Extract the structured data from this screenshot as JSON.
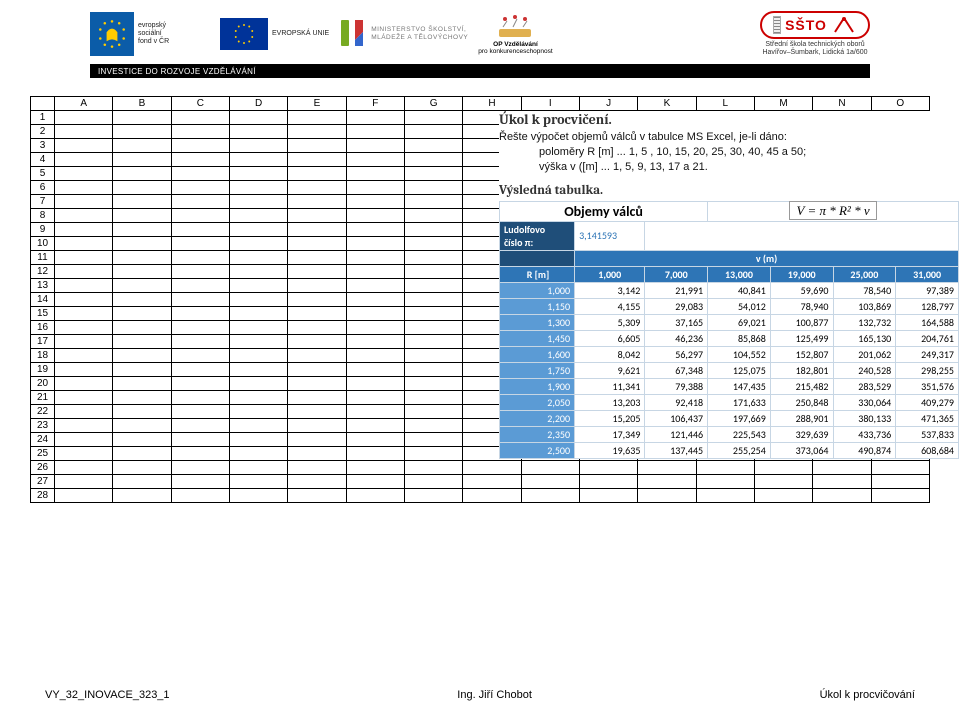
{
  "banner": {
    "esf_lines": [
      "evropský",
      "sociální",
      "fond v ČR"
    ],
    "eu_label": "EVROPSKÁ UNIE",
    "msmt_line1": "MINISTERSTVO ŠKOLSTVÍ,",
    "msmt_line2": "MLÁDEŽE A TĚLOVÝCHOVY",
    "opvk_line1": "OP Vzdělávání",
    "opvk_line2": "pro konkurenceschopnost",
    "ssto_name": "SŠTO",
    "ssto_line1": "Střední škola technických oborů",
    "ssto_line2": "Havířov–Šumbark, Lidická 1a/600",
    "black_bar": "INVESTICE DO ROZVOJE VZDĚLÁVÁNÍ"
  },
  "sheet": {
    "cols": [
      "A",
      "B",
      "C",
      "D",
      "E",
      "F",
      "G",
      "H",
      "I",
      "J",
      "K",
      "L",
      "M",
      "N",
      "O"
    ],
    "rows": 28
  },
  "task": {
    "title": "Úkol k procvičení.",
    "line1": "Řešte výpočet objemů válců v tabulce MS Excel, je-li dáno:",
    "line2": "poloměry R [m] ... 1, 5 , 10, 15, 20, 25, 30, 40, 45 a 50;",
    "line3": "výška v ([m] ... 1, 5, 9, 13, 17 a 21.",
    "subtitle": "Výsledná tabulka."
  },
  "chart_data": {
    "type": "table",
    "title": "Objemy válců",
    "formula": "V = π * R² * v",
    "pi_label_1": "Ludolfovo",
    "pi_label_2": "číslo π:",
    "pi_value": "3,141593",
    "col_header_group": "v (m)",
    "row_header_label": "R [m]",
    "v_values": [
      "1,000",
      "7,000",
      "13,000",
      "19,000",
      "25,000",
      "31,000"
    ],
    "r_values": [
      "1,000",
      "1,150",
      "1,300",
      "1,450",
      "1,600",
      "1,750",
      "1,900",
      "2,050",
      "2,200",
      "2,350",
      "2,500"
    ],
    "cells": [
      [
        "3,142",
        "21,991",
        "40,841",
        "59,690",
        "78,540",
        "97,389"
      ],
      [
        "4,155",
        "29,083",
        "54,012",
        "78,940",
        "103,869",
        "128,797"
      ],
      [
        "5,309",
        "37,165",
        "69,021",
        "100,877",
        "132,732",
        "164,588"
      ],
      [
        "6,605",
        "46,236",
        "85,868",
        "125,499",
        "165,130",
        "204,761"
      ],
      [
        "8,042",
        "56,297",
        "104,552",
        "152,807",
        "201,062",
        "249,317"
      ],
      [
        "9,621",
        "67,348",
        "125,075",
        "182,801",
        "240,528",
        "298,255"
      ],
      [
        "11,341",
        "79,388",
        "147,435",
        "215,482",
        "283,529",
        "351,576"
      ],
      [
        "13,203",
        "92,418",
        "171,633",
        "250,848",
        "330,064",
        "409,279"
      ],
      [
        "15,205",
        "106,437",
        "197,669",
        "288,901",
        "380,133",
        "471,365"
      ],
      [
        "17,349",
        "121,446",
        "225,543",
        "329,639",
        "433,736",
        "537,833"
      ],
      [
        "19,635",
        "137,445",
        "255,254",
        "373,064",
        "490,874",
        "608,684"
      ]
    ]
  },
  "footer": {
    "left": "VY_32_INOVACE_323_1",
    "center": "Ing. Jiří Chobot",
    "right": "Úkol k procvičování"
  }
}
